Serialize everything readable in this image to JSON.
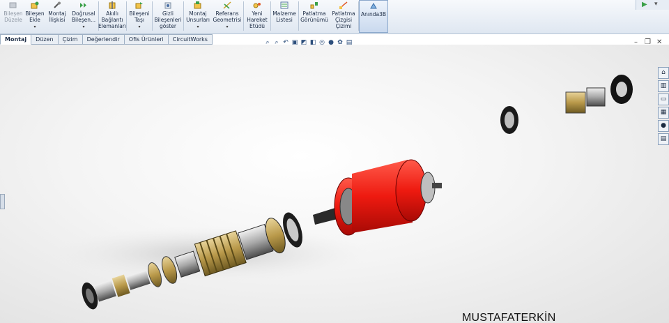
{
  "ribbon": {
    "buttons": [
      {
        "label": "Bileşen\nDüzele",
        "icon": "edit-component-icon",
        "state": "disabled"
      },
      {
        "label": "Bileşen\nEkle",
        "icon": "insert-component-icon",
        "dropdown": "▾"
      },
      {
        "label": "Montaj\nİlişkisi",
        "icon": "mate-icon"
      },
      {
        "label": "Doğrusal\nBileşen...",
        "icon": "linear-pattern-icon",
        "dropdown": "▾"
      },
      {
        "label": "Akıllı\nBağlantı\nElemanları",
        "icon": "smart-fasteners-icon"
      },
      {
        "label": "Bileşeni\nTaşı",
        "icon": "move-component-icon",
        "dropdown": "▾"
      },
      {
        "label": "Gizli\nBileşenleri\ngöster",
        "icon": "show-hidden-icon"
      },
      {
        "label": "Montaj\nUnsurları",
        "icon": "assembly-features-icon",
        "dropdown": "▾"
      },
      {
        "label": "Referans\nGeometrisi",
        "icon": "reference-geometry-icon",
        "dropdown": "▾"
      },
      {
        "label": "Yeni\nHareket\nEtüdü",
        "icon": "motion-study-icon"
      },
      {
        "label": "Malzeme\nListesi",
        "icon": "bom-icon"
      },
      {
        "label": "Patlatma\nGörünümü",
        "icon": "exploded-view-icon"
      },
      {
        "label": "Patlatma\nÇizgisi\nÇizimi",
        "icon": "explode-line-icon"
      },
      {
        "label": "Anında3B",
        "icon": "instant3d-icon",
        "state": "active"
      }
    ]
  },
  "tabs": [
    "Montaj",
    "Düzen",
    "Çizim",
    "Değerlendir",
    "Ofis Ürünleri",
    "CircuitWorks"
  ],
  "active_tab": "Montaj",
  "viewport": {
    "author_text": "MUSTAFATERKİN"
  }
}
